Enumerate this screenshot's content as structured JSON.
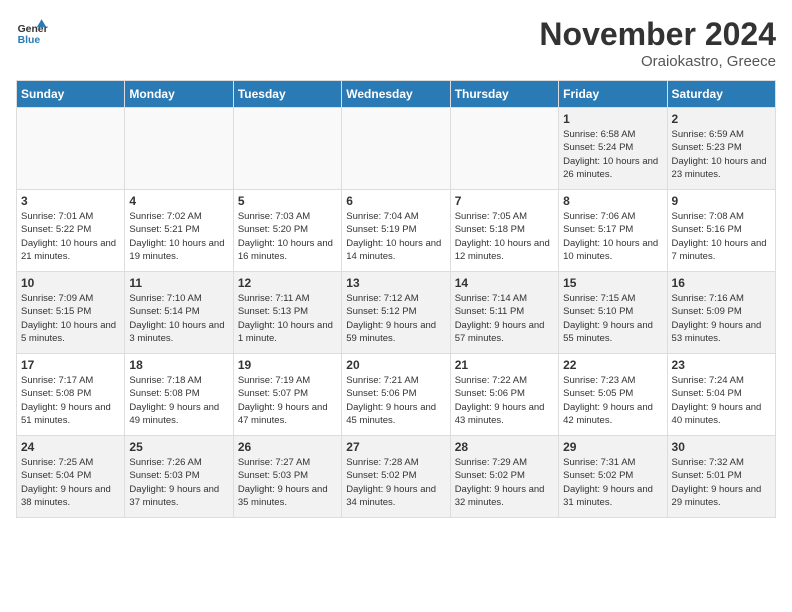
{
  "header": {
    "logo_line1": "General",
    "logo_line2": "Blue",
    "month": "November 2024",
    "location": "Oraiokastro, Greece"
  },
  "days_of_week": [
    "Sunday",
    "Monday",
    "Tuesday",
    "Wednesday",
    "Thursday",
    "Friday",
    "Saturday"
  ],
  "weeks": [
    [
      {
        "num": "",
        "info": ""
      },
      {
        "num": "",
        "info": ""
      },
      {
        "num": "",
        "info": ""
      },
      {
        "num": "",
        "info": ""
      },
      {
        "num": "",
        "info": ""
      },
      {
        "num": "1",
        "info": "Sunrise: 6:58 AM\nSunset: 5:24 PM\nDaylight: 10 hours and 26 minutes."
      },
      {
        "num": "2",
        "info": "Sunrise: 6:59 AM\nSunset: 5:23 PM\nDaylight: 10 hours and 23 minutes."
      }
    ],
    [
      {
        "num": "3",
        "info": "Sunrise: 7:01 AM\nSunset: 5:22 PM\nDaylight: 10 hours and 21 minutes."
      },
      {
        "num": "4",
        "info": "Sunrise: 7:02 AM\nSunset: 5:21 PM\nDaylight: 10 hours and 19 minutes."
      },
      {
        "num": "5",
        "info": "Sunrise: 7:03 AM\nSunset: 5:20 PM\nDaylight: 10 hours and 16 minutes."
      },
      {
        "num": "6",
        "info": "Sunrise: 7:04 AM\nSunset: 5:19 PM\nDaylight: 10 hours and 14 minutes."
      },
      {
        "num": "7",
        "info": "Sunrise: 7:05 AM\nSunset: 5:18 PM\nDaylight: 10 hours and 12 minutes."
      },
      {
        "num": "8",
        "info": "Sunrise: 7:06 AM\nSunset: 5:17 PM\nDaylight: 10 hours and 10 minutes."
      },
      {
        "num": "9",
        "info": "Sunrise: 7:08 AM\nSunset: 5:16 PM\nDaylight: 10 hours and 7 minutes."
      }
    ],
    [
      {
        "num": "10",
        "info": "Sunrise: 7:09 AM\nSunset: 5:15 PM\nDaylight: 10 hours and 5 minutes."
      },
      {
        "num": "11",
        "info": "Sunrise: 7:10 AM\nSunset: 5:14 PM\nDaylight: 10 hours and 3 minutes."
      },
      {
        "num": "12",
        "info": "Sunrise: 7:11 AM\nSunset: 5:13 PM\nDaylight: 10 hours and 1 minute."
      },
      {
        "num": "13",
        "info": "Sunrise: 7:12 AM\nSunset: 5:12 PM\nDaylight: 9 hours and 59 minutes."
      },
      {
        "num": "14",
        "info": "Sunrise: 7:14 AM\nSunset: 5:11 PM\nDaylight: 9 hours and 57 minutes."
      },
      {
        "num": "15",
        "info": "Sunrise: 7:15 AM\nSunset: 5:10 PM\nDaylight: 9 hours and 55 minutes."
      },
      {
        "num": "16",
        "info": "Sunrise: 7:16 AM\nSunset: 5:09 PM\nDaylight: 9 hours and 53 minutes."
      }
    ],
    [
      {
        "num": "17",
        "info": "Sunrise: 7:17 AM\nSunset: 5:08 PM\nDaylight: 9 hours and 51 minutes."
      },
      {
        "num": "18",
        "info": "Sunrise: 7:18 AM\nSunset: 5:08 PM\nDaylight: 9 hours and 49 minutes."
      },
      {
        "num": "19",
        "info": "Sunrise: 7:19 AM\nSunset: 5:07 PM\nDaylight: 9 hours and 47 minutes."
      },
      {
        "num": "20",
        "info": "Sunrise: 7:21 AM\nSunset: 5:06 PM\nDaylight: 9 hours and 45 minutes."
      },
      {
        "num": "21",
        "info": "Sunrise: 7:22 AM\nSunset: 5:06 PM\nDaylight: 9 hours and 43 minutes."
      },
      {
        "num": "22",
        "info": "Sunrise: 7:23 AM\nSunset: 5:05 PM\nDaylight: 9 hours and 42 minutes."
      },
      {
        "num": "23",
        "info": "Sunrise: 7:24 AM\nSunset: 5:04 PM\nDaylight: 9 hours and 40 minutes."
      }
    ],
    [
      {
        "num": "24",
        "info": "Sunrise: 7:25 AM\nSunset: 5:04 PM\nDaylight: 9 hours and 38 minutes."
      },
      {
        "num": "25",
        "info": "Sunrise: 7:26 AM\nSunset: 5:03 PM\nDaylight: 9 hours and 37 minutes."
      },
      {
        "num": "26",
        "info": "Sunrise: 7:27 AM\nSunset: 5:03 PM\nDaylight: 9 hours and 35 minutes."
      },
      {
        "num": "27",
        "info": "Sunrise: 7:28 AM\nSunset: 5:02 PM\nDaylight: 9 hours and 34 minutes."
      },
      {
        "num": "28",
        "info": "Sunrise: 7:29 AM\nSunset: 5:02 PM\nDaylight: 9 hours and 32 minutes."
      },
      {
        "num": "29",
        "info": "Sunrise: 7:31 AM\nSunset: 5:02 PM\nDaylight: 9 hours and 31 minutes."
      },
      {
        "num": "30",
        "info": "Sunrise: 7:32 AM\nSunset: 5:01 PM\nDaylight: 9 hours and 29 minutes."
      }
    ]
  ]
}
